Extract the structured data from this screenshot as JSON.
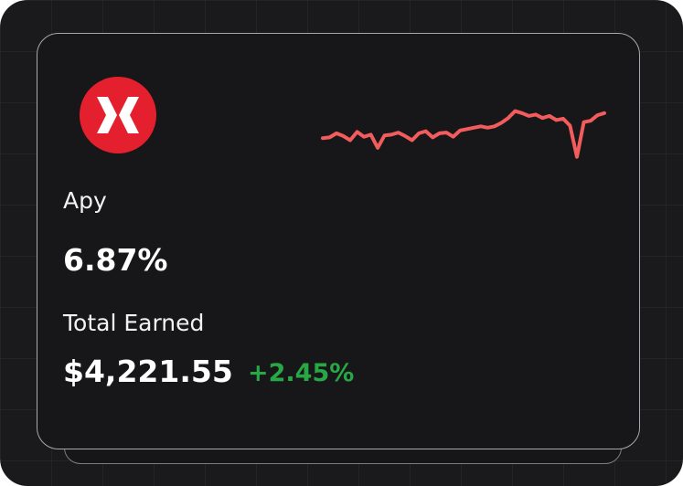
{
  "card": {
    "apy_label": "Apy",
    "apy_value": "6.87%",
    "total_earned_label": "Total Earned",
    "total_earned_value": "$4,221.55",
    "change_value": "+2.45%"
  },
  "icons": {
    "logo": "brand-x-logo-icon"
  },
  "colors": {
    "background": "#1a191b",
    "card": "#171618",
    "logo_red": "#e5202e",
    "sparkline": "#f25c5c",
    "positive": "#28a745",
    "text": "#ffffff"
  },
  "sparkline_values": [
    0.3,
    0.31,
    0.37,
    0.33,
    0.27,
    0.39,
    0.32,
    0.35,
    0.16,
    0.34,
    0.35,
    0.38,
    0.33,
    0.27,
    0.37,
    0.4,
    0.31,
    0.37,
    0.38,
    0.32,
    0.41,
    0.43,
    0.45,
    0.47,
    0.45,
    0.47,
    0.52,
    0.59,
    0.69,
    0.66,
    0.62,
    0.64,
    0.59,
    0.62,
    0.56,
    0.58,
    0.48,
    0.03,
    0.53,
    0.55,
    0.63,
    0.66
  ]
}
